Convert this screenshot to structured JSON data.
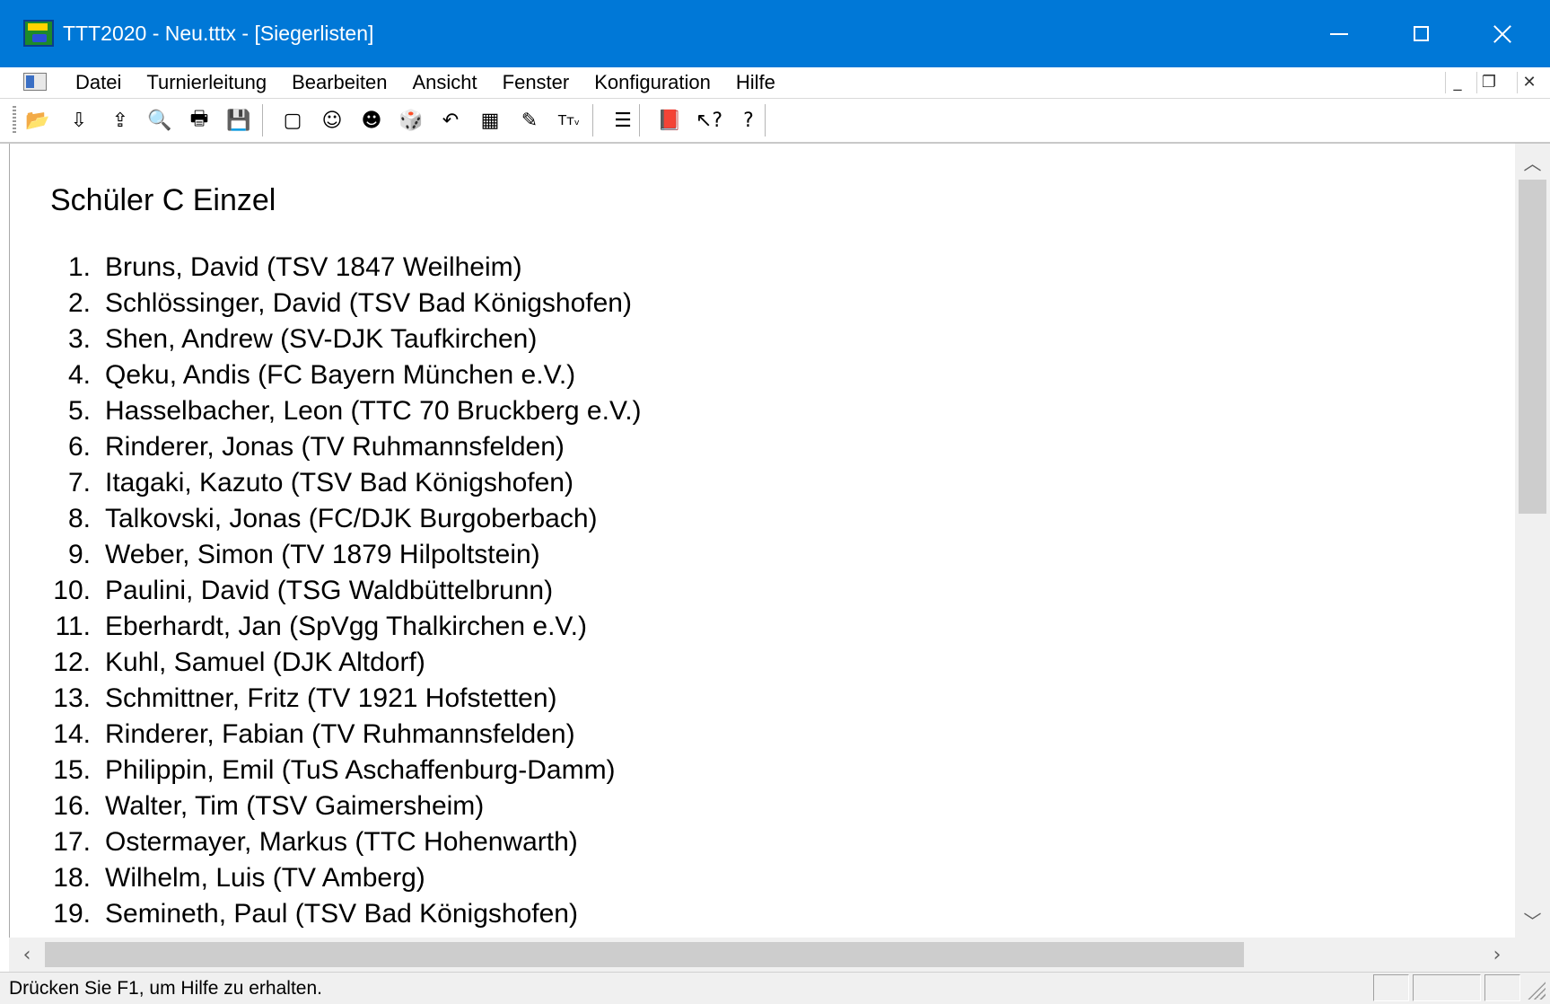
{
  "window": {
    "title": "TTT2020 - Neu.tttx - [Siegerlisten]",
    "title_bar_color": "#0078d7"
  },
  "menu": {
    "items": [
      "Datei",
      "Turnierleitung",
      "Bearbeiten",
      "Ansicht",
      "Fenster",
      "Konfiguration",
      "Hilfe"
    ]
  },
  "toolbar": {
    "icons": [
      "open-folder-icon",
      "import-icon",
      "export-icon",
      "print-preview-icon",
      "print-icon",
      "save-icon",
      "window-icon",
      "players-icon",
      "doubles-icon",
      "dice-icon",
      "arrow-icon",
      "calendar-icon",
      "note-icon",
      "text-size-icon",
      "list-icon",
      "book-icon",
      "context-help-icon",
      "help-icon"
    ],
    "glyphs": [
      "📂",
      "⇩",
      "⇪",
      "🔍",
      "🖶",
      "💾",
      "▢",
      "☺",
      "☻",
      "🎲",
      "↶",
      "▦",
      "✎",
      "Tᴛᵥ",
      "☰",
      "📕",
      "↖?",
      "?"
    ]
  },
  "document": {
    "heading": "Schüler C Einzel",
    "rows": [
      {
        "rank": "1.",
        "text": "Bruns, David (TSV 1847 Weilheim)"
      },
      {
        "rank": "2.",
        "text": "Schlössinger, David (TSV Bad Königshofen)"
      },
      {
        "rank": "3.",
        "text": "Shen, Andrew (SV-DJK Taufkirchen)"
      },
      {
        "rank": "4.",
        "text": "Qeku, Andis (FC Bayern München e.V.)"
      },
      {
        "rank": "5.",
        "text": "Hasselbacher, Leon (TTC 70 Bruckberg e.V.)"
      },
      {
        "rank": "6.",
        "text": "Rinderer, Jonas (TV Ruhmannsfelden)"
      },
      {
        "rank": "7.",
        "text": "Itagaki, Kazuto (TSV Bad Königshofen)"
      },
      {
        "rank": "8.",
        "text": "Talkovski, Jonas (FC/DJK Burgoberbach)"
      },
      {
        "rank": "9.",
        "text": "Weber, Simon (TV 1879 Hilpoltstein)"
      },
      {
        "rank": "10.",
        "text": "Paulini, David (TSG Waldbüttelbrunn)"
      },
      {
        "rank": "11.",
        "text": "Eberhardt, Jan (SpVgg Thalkirchen e.V.)"
      },
      {
        "rank": "12.",
        "text": "Kuhl, Samuel (DJK Altdorf)"
      },
      {
        "rank": "13.",
        "text": "Schmittner, Fritz (TV 1921 Hofstetten)"
      },
      {
        "rank": "14.",
        "text": "Rinderer, Fabian (TV Ruhmannsfelden)"
      },
      {
        "rank": "15.",
        "text": "Philippin, Emil (TuS Aschaffenburg-Damm)"
      },
      {
        "rank": "16.",
        "text": "Walter, Tim (TSV Gaimersheim)"
      },
      {
        "rank": "17.",
        "text": "Ostermayer, Markus (TTC Hohenwarth)"
      },
      {
        "rank": "18.",
        "text": "Wilhelm, Luis (TV Amberg)"
      },
      {
        "rank": "19.",
        "text": "Semineth, Paul (TSV Bad Königshofen)"
      }
    ]
  },
  "statusbar": {
    "text": "Drücken Sie F1, um Hilfe zu erhalten."
  }
}
